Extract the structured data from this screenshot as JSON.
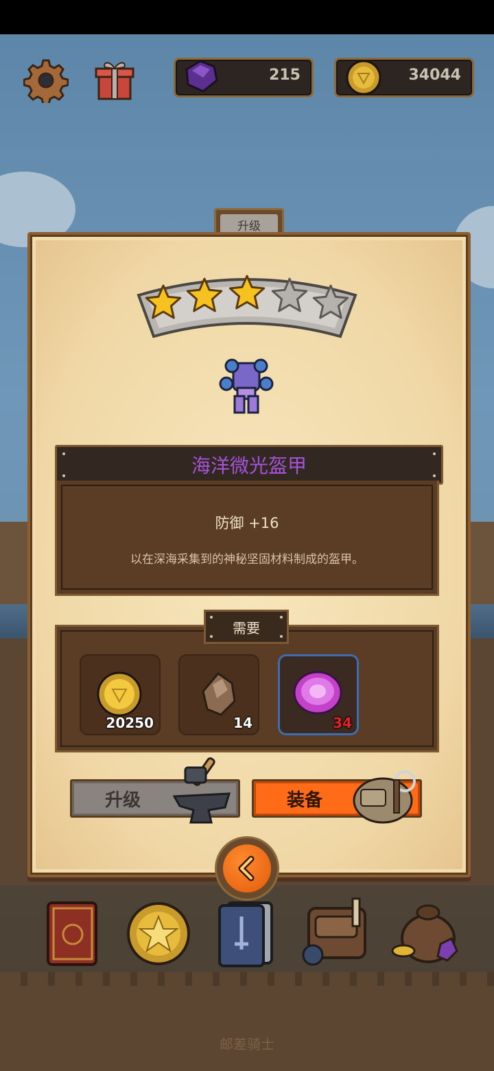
{
  "hud": {
    "gems": "215",
    "coins": "34044",
    "icons": [
      "gear-icon",
      "gift-icon",
      "gem-icon",
      "coin-icon"
    ]
  },
  "panel": {
    "tab_label": "升级",
    "stars": {
      "filled": 3,
      "total": 5
    },
    "item_name": "海洋微光盔甲",
    "stat": "防御 +16",
    "description": "以在深海采集到的神秘坚固材料制成的盔甲。",
    "requirement_label": "需要",
    "requirements": [
      {
        "icon": "coin-icon",
        "qty": "20250"
      },
      {
        "icon": "ore-icon",
        "qty": "14"
      },
      {
        "icon": "pink-crystal-icon",
        "qty": "34",
        "insufficient": true
      }
    ],
    "upgrade_label": "升级",
    "equip_label": "装备"
  },
  "nav": {
    "items": [
      "book-icon",
      "star-coin-icon",
      "card-deck-icon",
      "backpack-icon",
      "loot-bag-icon"
    ]
  },
  "footer": {
    "title": "邮差骑士"
  },
  "colors": {
    "item_name": "#a653d9",
    "equip_button": "#ff6b16",
    "insufficient": "#e62424"
  }
}
